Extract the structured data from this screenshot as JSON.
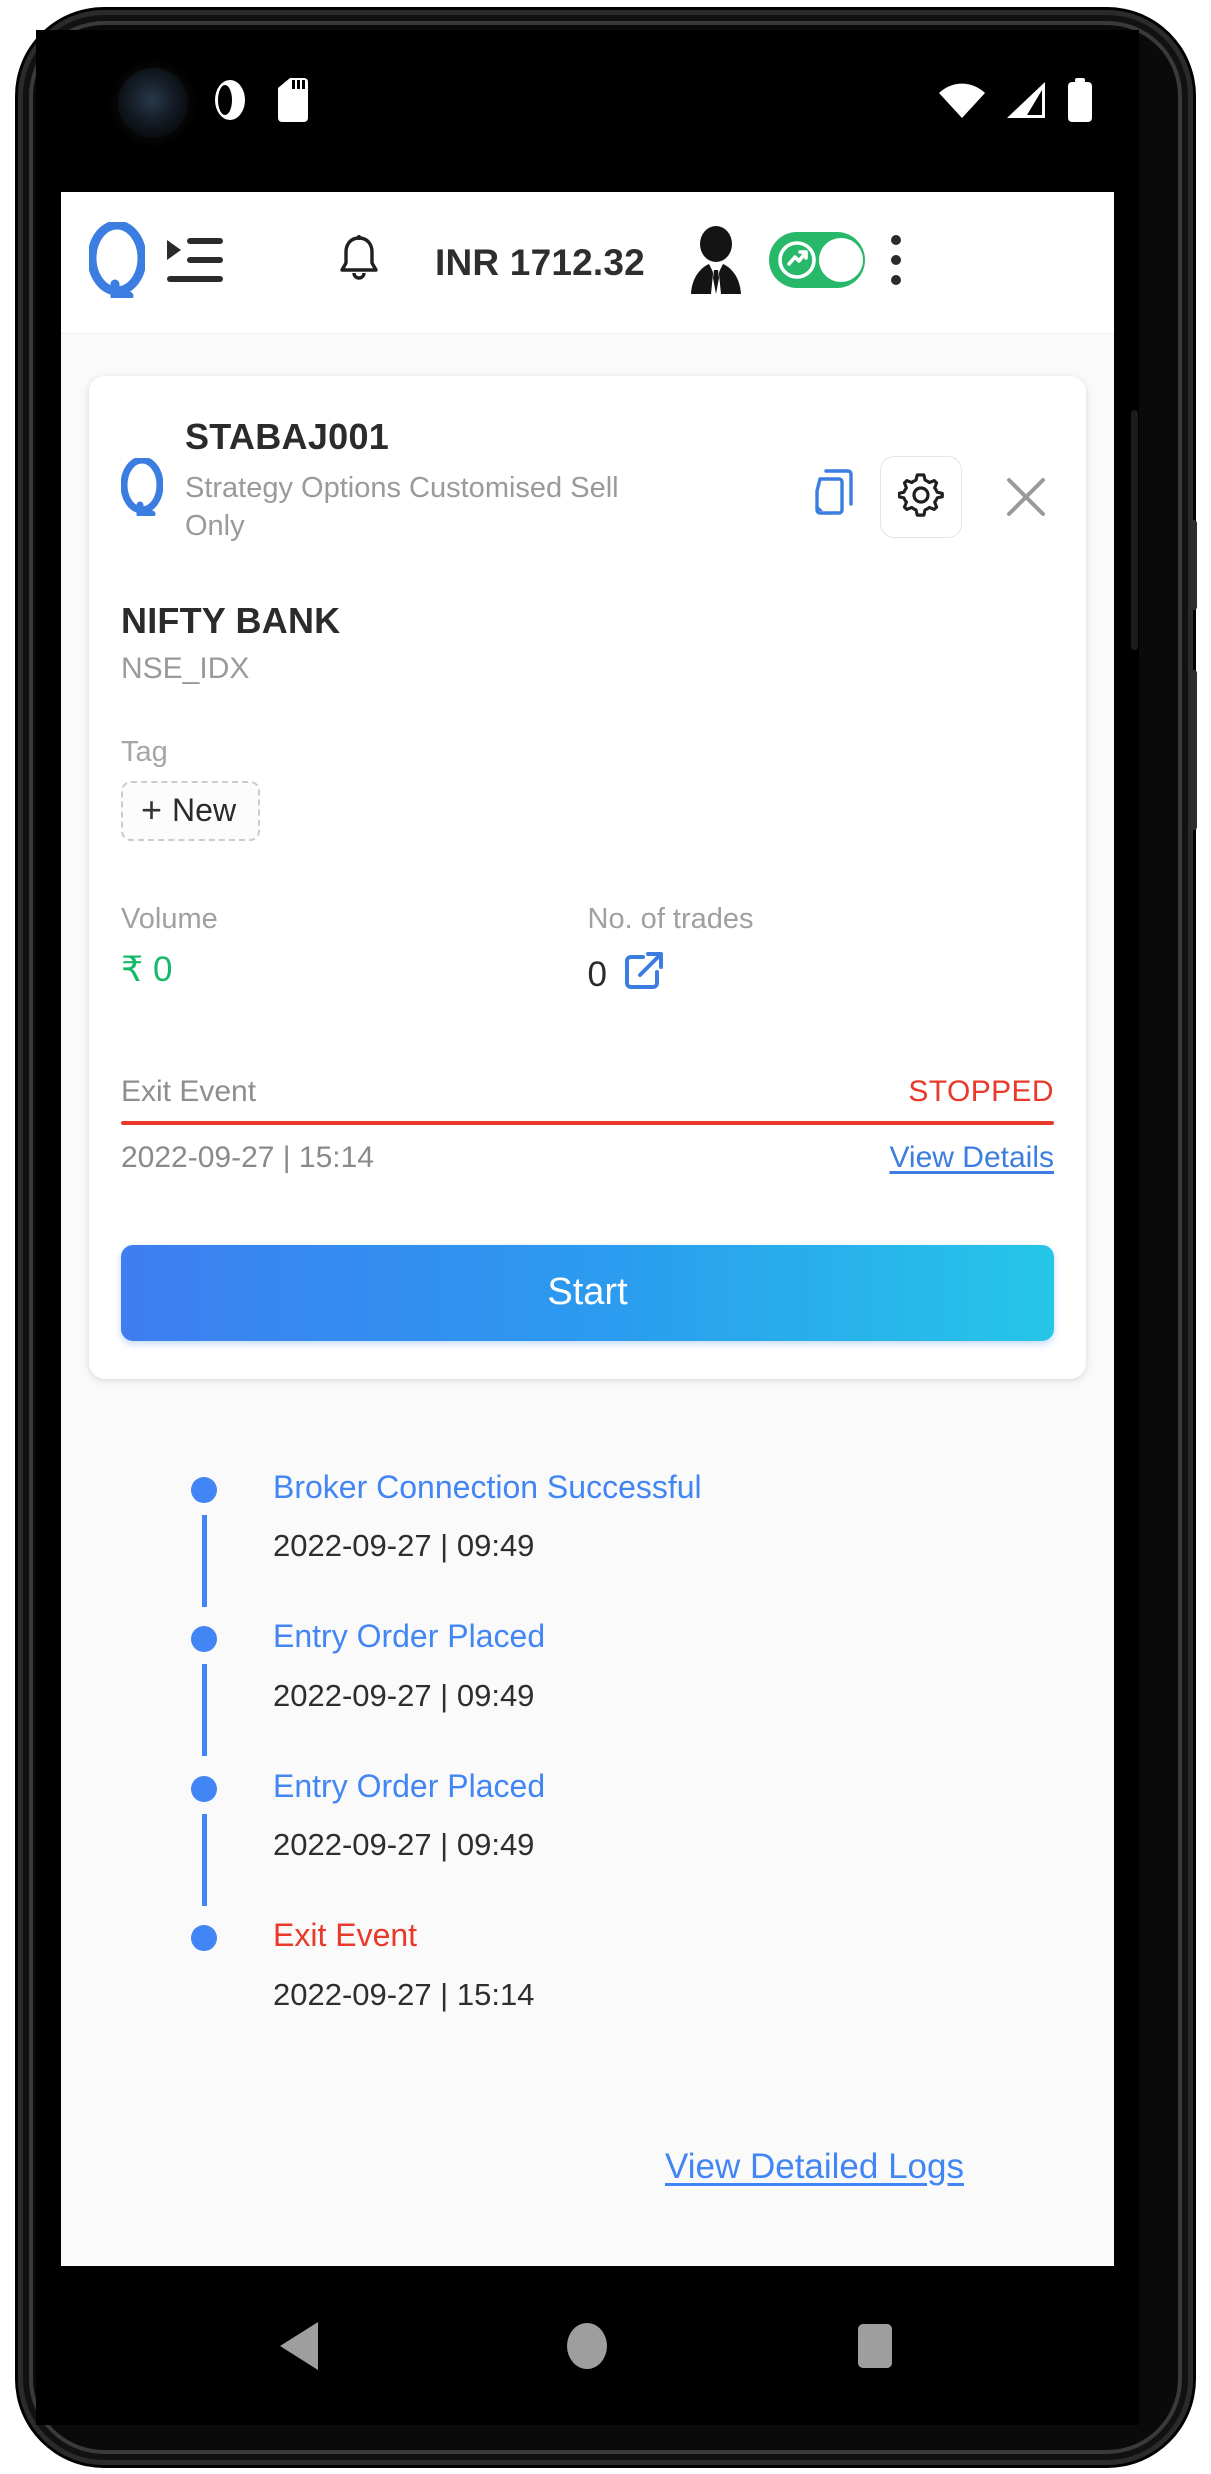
{
  "status_bar": {
    "left_icons": [
      "crescent-icon",
      "camera-punch-hole",
      "ring-icon",
      "sd-card-icon"
    ],
    "right_icons": [
      "wifi-icon",
      "cellular-signal-icon",
      "battery-icon"
    ]
  },
  "header": {
    "logo": "quantman-q-logo",
    "menu_icon": "list-indent-icon",
    "bell_icon": "notification-bell-icon",
    "balance": "INR 1712.32",
    "avatar_icon": "businessman-avatar-icon",
    "toggle": {
      "name": "live-trading-toggle",
      "state": "on",
      "color": "#27b86a",
      "icon": "trending-chart-icon"
    },
    "kebab_icon": "more-vertical-icon"
  },
  "card": {
    "logo": "quantman-q-logo",
    "title": "STABAJ001",
    "subtitle": "Strategy Options Customised Sell Only",
    "copy_icon": "copy-duplicate-icon",
    "gear_icon": "settings-gear-icon",
    "close_icon": "close-x-icon",
    "instrument_name": "NIFTY BANK",
    "instrument_exchange": "NSE_IDX",
    "tag_label": "Tag",
    "tag_new_button": "New",
    "tag_plus": "+",
    "stats": [
      {
        "label": "Volume",
        "value": "₹ 0",
        "color": "#18b86a",
        "name": "volume"
      },
      {
        "label": "No. of trades",
        "value": "0",
        "color": "#2b2b2b",
        "name": "no-of-trades",
        "icon": "external-link-icon"
      }
    ],
    "exit_event": {
      "label": "Exit Event",
      "status": "STOPPED",
      "status_color": "#e8392b",
      "timestamp": "2022-09-27 | 15:14",
      "details_link": "View Details"
    },
    "start_button": "Start"
  },
  "timeline": {
    "items": [
      {
        "title": "Broker Connection Successful",
        "time": "2022-09-27 | 09:49",
        "type": "blue"
      },
      {
        "title": "Entry Order Placed",
        "time": "2022-09-27 | 09:49",
        "type": "blue"
      },
      {
        "title": "Entry Order Placed",
        "time": "2022-09-27 | 09:49",
        "type": "blue"
      },
      {
        "title": "Exit Event",
        "time": "2022-09-27 | 15:14",
        "type": "red"
      }
    ],
    "view_logs_link": "View Detailed Logs"
  },
  "nav_bar": {
    "back": "back-triangle-icon",
    "home": "home-circle-icon",
    "recents": "recents-square-icon"
  }
}
